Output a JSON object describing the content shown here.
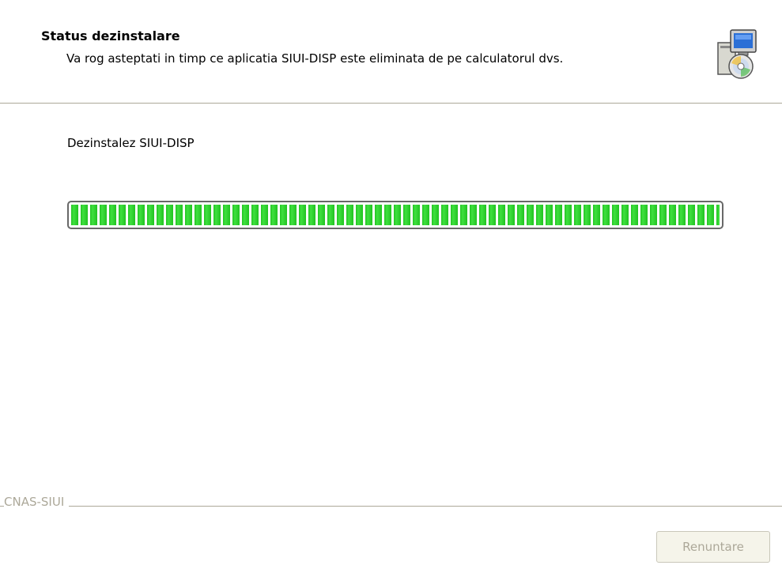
{
  "header": {
    "title": "Status dezinstalare",
    "subtitle": "Va rog asteptati in timp ce aplicatia SIUI-DISP  este eliminata de pe calculatorul dvs.",
    "icon": "installer-computer-cd-icon"
  },
  "main": {
    "status_text": "Dezinstalez SIUI-DISP",
    "progress": {
      "percent": 100,
      "color": "#2ad02a"
    }
  },
  "footer": {
    "brand_label": "CNAS-SIUI",
    "cancel_label": "Renuntare",
    "cancel_enabled": false
  },
  "colors": {
    "rule": "#aca899",
    "disabled_text": "#aca899",
    "progress_green": "#2ad02a"
  }
}
